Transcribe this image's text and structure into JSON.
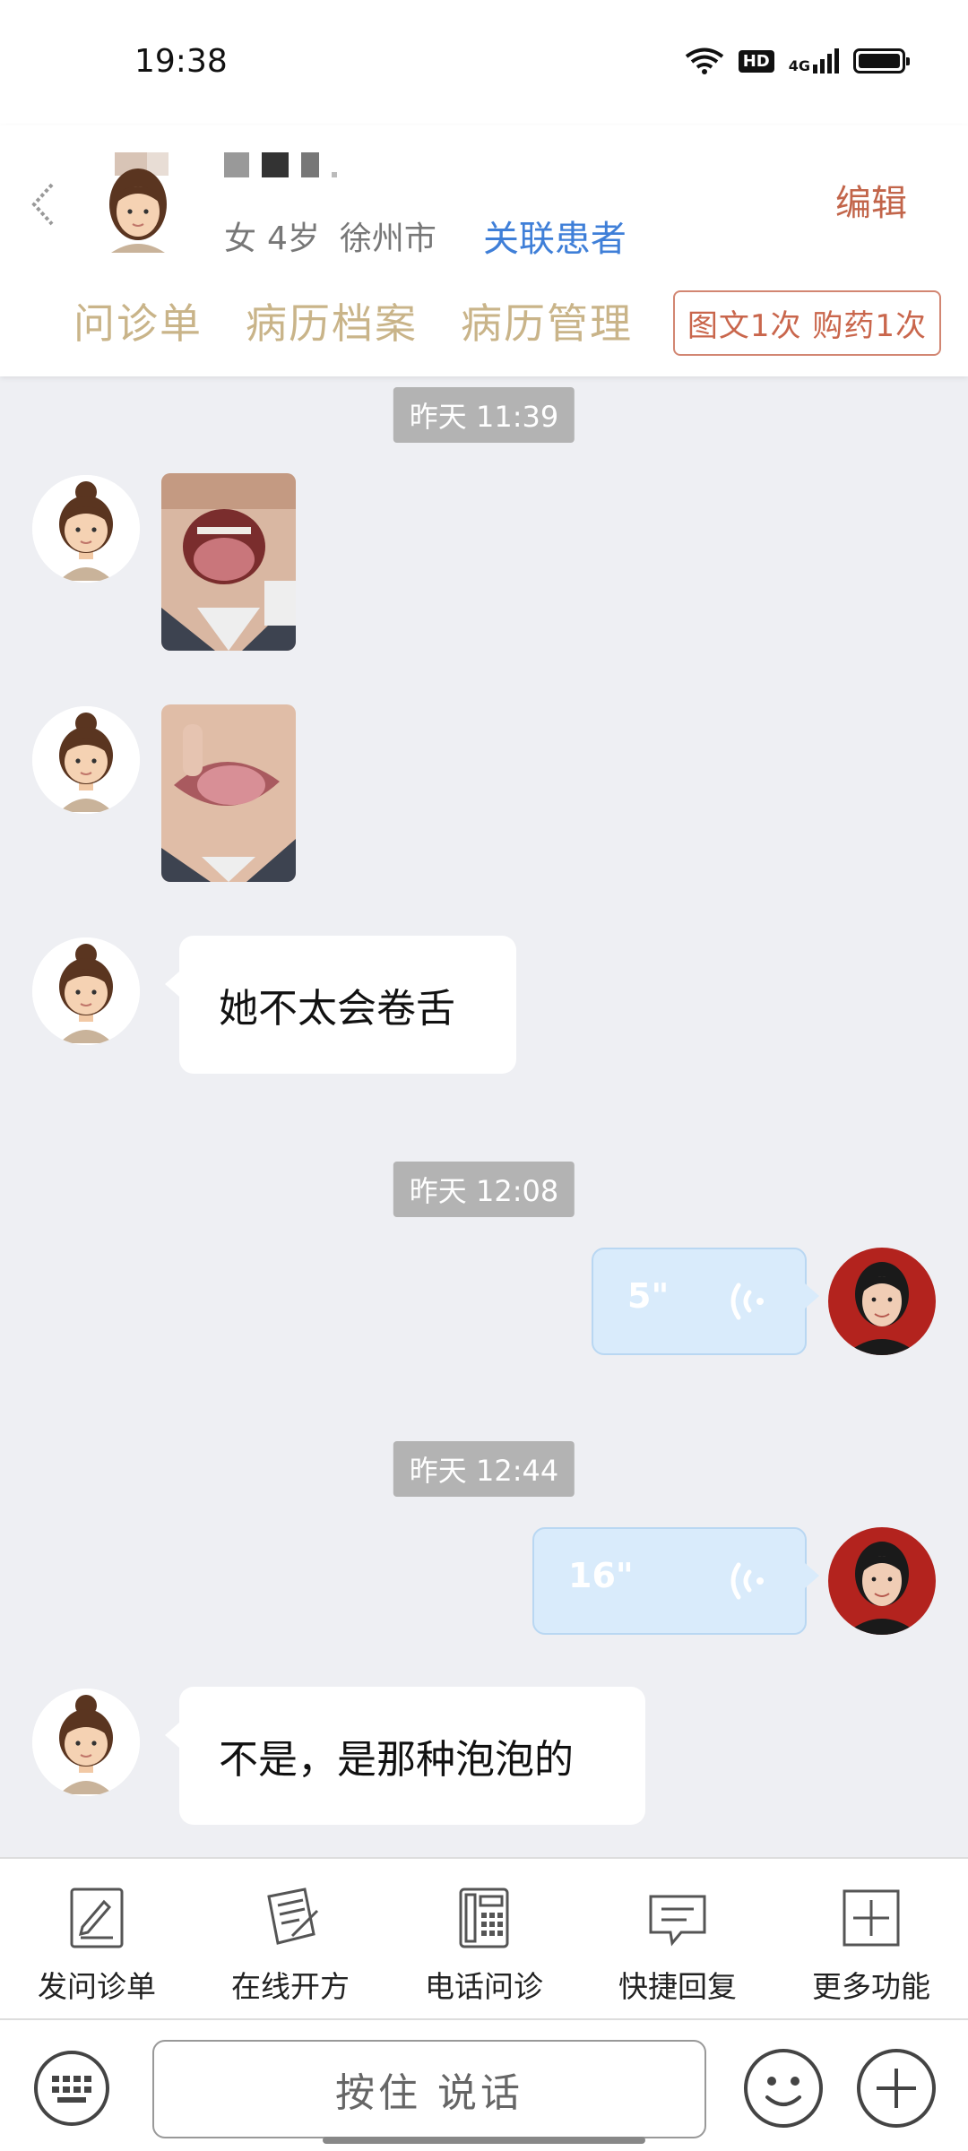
{
  "status_bar": {
    "time": "19:38",
    "hd_label": "HD",
    "network_label": "4G",
    "battery_level": 1.0
  },
  "header": {
    "patient_meta": {
      "gender": "女",
      "age": "4岁",
      "city": "徐州市"
    },
    "link_patient": "关联患者",
    "edit": "编辑",
    "tabs": [
      "问诊单",
      "病历档案",
      "病历管理"
    ],
    "quota": "图文1次 购药1次"
  },
  "chat": {
    "timestamps": [
      "昨天 11:39",
      "昨天 12:08",
      "昨天 12:44"
    ],
    "messages": [
      {
        "from": "patient",
        "type": "image",
        "description": "open-mouth-photo"
      },
      {
        "from": "patient",
        "type": "image",
        "description": "tongue-photo"
      },
      {
        "from": "patient",
        "type": "text",
        "text": "她不太会卷舌"
      },
      {
        "from": "doctor",
        "type": "voice",
        "duration": "5\""
      },
      {
        "from": "doctor",
        "type": "voice",
        "duration": "16\""
      },
      {
        "from": "patient",
        "type": "text",
        "text": "不是，是那种泡泡的"
      }
    ]
  },
  "function_bar": [
    {
      "label": "发问诊单",
      "icon": "form-edit-icon"
    },
    {
      "label": "在线开方",
      "icon": "prescription-icon"
    },
    {
      "label": "电话问诊",
      "icon": "phone-icon"
    },
    {
      "label": "快捷回复",
      "icon": "quick-reply-icon"
    },
    {
      "label": "更多功能",
      "icon": "plus-square-icon"
    }
  ],
  "input_bar": {
    "hold_to_talk": "按住 说话"
  },
  "colors": {
    "accent_blue": "#3f7fd8",
    "edit_red": "#c2654a",
    "tab_gold": "#c9b489",
    "voice_bubble": "#d9ebfb"
  }
}
